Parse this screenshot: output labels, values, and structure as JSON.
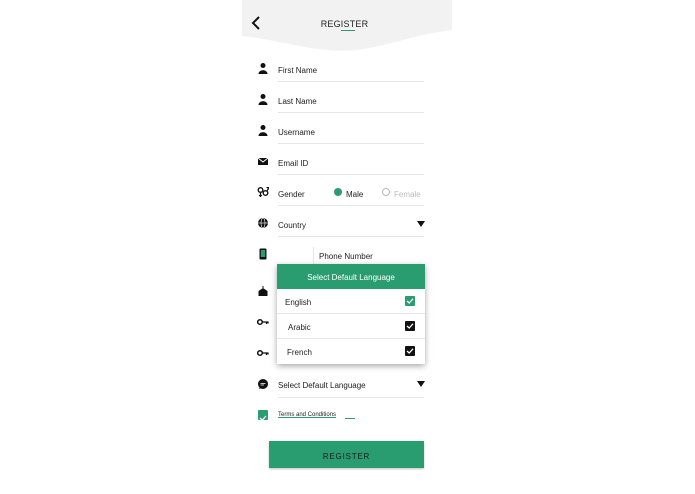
{
  "header": {
    "title": "REGISTER"
  },
  "form": {
    "first_name": {
      "placeholder": "First Name"
    },
    "last_name": {
      "placeholder": "Last Name"
    },
    "username": {
      "placeholder": "Username"
    },
    "email": {
      "placeholder": "Email ID"
    },
    "gender": {
      "label": "Gender",
      "options": [
        {
          "label": "Male",
          "selected": true
        },
        {
          "label": "Female",
          "selected": false
        }
      ]
    },
    "country": {
      "placeholder": "Country"
    },
    "phone": {
      "placeholder": "Phone Number"
    },
    "default_language": {
      "placeholder": "Select Default Language"
    },
    "terms": {
      "label": "Terms and Conditions",
      "checked": true
    },
    "register_label": "REGISTER"
  },
  "language_popup": {
    "title": "Select Default Language",
    "items": [
      {
        "label": "English",
        "checked": true
      },
      {
        "label": "Arabic",
        "checked": true
      },
      {
        "label": "French",
        "checked": true
      }
    ]
  },
  "colors": {
    "accent": "#2a9d70",
    "dark": "#111111"
  },
  "icons": {
    "back": "chevron-left-icon",
    "person": "person-icon",
    "email": "envelope-icon",
    "gender": "gender-icon",
    "country": "globe-icon",
    "phone": "phone-icon",
    "key": "key-icon",
    "cake": "cake-icon",
    "chat": "chat-icon",
    "dropdown": "triangle-down-icon"
  }
}
